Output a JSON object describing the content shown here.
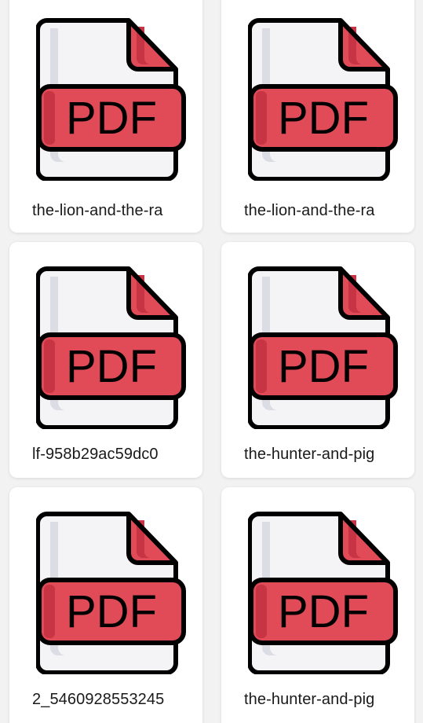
{
  "colors": {
    "background": "#f2f2f2",
    "card": "#ffffff",
    "pdf_red": "#e04b57",
    "pdf_red_dark": "#c73544",
    "page_fill": "#f4f4f6",
    "page_shadow": "#dcdce4",
    "outline": "#000000"
  },
  "icon_semantic": "pdf-file-icon",
  "files": [
    {
      "name": "the-lion-and-the-ra",
      "badge": "PDF"
    },
    {
      "name": "the-lion-and-the-ra",
      "badge": "PDF"
    },
    {
      "name": "lf-958b29ac59dc0",
      "badge": "PDF"
    },
    {
      "name": "the-hunter-and-pig",
      "badge": "PDF"
    },
    {
      "name": "2_5460928553245",
      "badge": "PDF"
    },
    {
      "name": "the-hunter-and-pig",
      "badge": "PDF"
    }
  ]
}
